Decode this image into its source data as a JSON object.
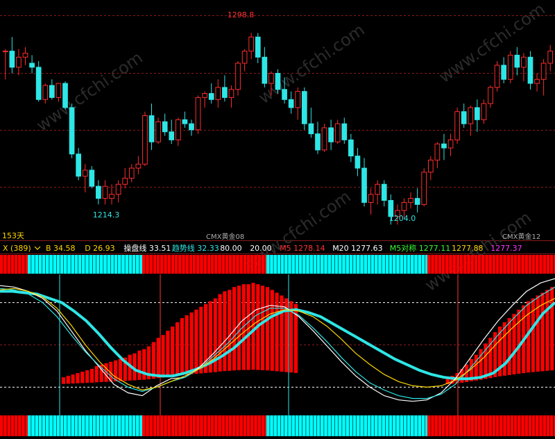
{
  "colors": {
    "up": "#ff2d2d",
    "down": "#2ee6e6",
    "white": "#ffffff",
    "grid_red": "#8b1a1a",
    "bar_red": "#ff0000",
    "bar_cyan": "#00ffff",
    "label_yellow": "#ffd700",
    "watermark": "#2b2b2b"
  },
  "main_panel": {
    "high_label": "1298.8",
    "low_label_left": "1214.3",
    "low_label_right": "1204.0",
    "period_label": "153天",
    "contract_label_mid": "CMX黄金08",
    "contract_label_right": "CMX黄金12",
    "watermark": "www.cfchi.com"
  },
  "indicator_header": {
    "dropdown_label": "X (389)",
    "items": [
      {
        "label": "B",
        "value": "34.58",
        "color": "#ffd700"
      },
      {
        "label": "D",
        "value": "26.93",
        "color": "#ffd700"
      },
      {
        "label": "操盘线",
        "value": "33.51",
        "color": "#ffffff"
      },
      {
        "label": "趋势线",
        "value": "32.33",
        "color": "#2ee6e6"
      },
      {
        "label": "",
        "value": "80.00",
        "color": "#ffffff"
      },
      {
        "label": "",
        "value": "20.00",
        "color": "#ffffff"
      },
      {
        "label": "M5",
        "value": "1278.14",
        "color": "#ff3333"
      },
      {
        "label": "M20",
        "value": "1277.63",
        "color": "#ffffff"
      },
      {
        "label": "M5对称",
        "value": "1277.11",
        "color": "#33ff33"
      },
      {
        "label": "",
        "value": "1277.88",
        "color": "#ffd700"
      },
      {
        "label": "",
        "value": "1277.37",
        "color": "#ff33ff"
      }
    ]
  },
  "chart_data": [
    {
      "type": "candlestick",
      "title": "",
      "ylim": [
        1200,
        1305
      ],
      "annotations": [
        {
          "text": "1298.8",
          "kind": "high"
        },
        {
          "text": "1214.3",
          "kind": "low"
        },
        {
          "text": "1204.0",
          "kind": "low"
        }
      ],
      "candles": [
        [
          1290,
          1291,
          1276,
          1290
        ],
        [
          1290,
          1297,
          1279,
          1282
        ],
        [
          1282,
          1291,
          1278,
          1287
        ],
        [
          1287,
          1292,
          1283,
          1289
        ],
        [
          1284,
          1288,
          1279,
          1282
        ],
        [
          1282,
          1285,
          1265,
          1266
        ],
        [
          1266,
          1274,
          1264,
          1273
        ],
        [
          1273,
          1276,
          1266,
          1267
        ],
        [
          1267,
          1274,
          1265,
          1274
        ],
        [
          1274,
          1275,
          1261,
          1262
        ],
        [
          1262,
          1264,
          1237,
          1239
        ],
        [
          1239,
          1242,
          1226,
          1228
        ],
        [
          1228,
          1234,
          1220,
          1231
        ],
        [
          1231,
          1233,
          1222,
          1223
        ],
        [
          1223,
          1226,
          1214,
          1217
        ],
        [
          1217,
          1226,
          1214,
          1223
        ],
        [
          1217,
          1224,
          1214,
          1219
        ],
        [
          1219,
          1226,
          1215,
          1224
        ],
        [
          1224,
          1232,
          1222,
          1227
        ],
        [
          1227,
          1234,
          1225,
          1232
        ],
        [
          1232,
          1238,
          1229,
          1234
        ],
        [
          1234,
          1260,
          1233,
          1258
        ],
        [
          1258,
          1264,
          1241,
          1245
        ],
        [
          1245,
          1257,
          1244,
          1255
        ],
        [
          1255,
          1259,
          1248,
          1250
        ],
        [
          1250,
          1256,
          1244,
          1246
        ],
        [
          1246,
          1257,
          1243,
          1256
        ],
        [
          1256,
          1260,
          1252,
          1254
        ],
        [
          1254,
          1256,
          1248,
          1251
        ],
        [
          1251,
          1268,
          1249,
          1267
        ],
        [
          1267,
          1270,
          1262,
          1269
        ],
        [
          1269,
          1274,
          1264,
          1266
        ],
        [
          1266,
          1276,
          1262,
          1272
        ],
        [
          1272,
          1278,
          1265,
          1267
        ],
        [
          1267,
          1273,
          1262,
          1271
        ],
        [
          1271,
          1285,
          1268,
          1284
        ],
        [
          1284,
          1291,
          1280,
          1290
        ],
        [
          1290,
          1299,
          1286,
          1297
        ],
        [
          1297,
          1299,
          1284,
          1287
        ],
        [
          1287,
          1292,
          1272,
          1274
        ],
        [
          1274,
          1280,
          1268,
          1279
        ],
        [
          1279,
          1281,
          1269,
          1271
        ],
        [
          1271,
          1277,
          1264,
          1266
        ],
        [
          1266,
          1270,
          1259,
          1262
        ],
        [
          1262,
          1272,
          1256,
          1270
        ],
        [
          1270,
          1272,
          1251,
          1254
        ],
        [
          1254,
          1262,
          1247,
          1249
        ],
        [
          1249,
          1255,
          1239,
          1241
        ],
        [
          1241,
          1254,
          1240,
          1252
        ],
        [
          1252,
          1256,
          1241,
          1245
        ],
        [
          1245,
          1256,
          1244,
          1254
        ],
        [
          1254,
          1257,
          1244,
          1246
        ],
        [
          1246,
          1249,
          1235,
          1238
        ],
        [
          1238,
          1242,
          1228,
          1232
        ],
        [
          1232,
          1237,
          1213,
          1215
        ],
        [
          1215,
          1222,
          1209,
          1219
        ],
        [
          1219,
          1226,
          1214,
          1224
        ],
        [
          1224,
          1226,
          1213,
          1216
        ],
        [
          1216,
          1219,
          1204,
          1208
        ],
        [
          1208,
          1214,
          1204,
          1211
        ],
        [
          1211,
          1217,
          1207,
          1215
        ],
        [
          1215,
          1220,
          1212,
          1217
        ],
        [
          1217,
          1222,
          1210,
          1214
        ],
        [
          1214,
          1232,
          1213,
          1230
        ],
        [
          1230,
          1238,
          1226,
          1236
        ],
        [
          1236,
          1245,
          1232,
          1244
        ],
        [
          1244,
          1249,
          1236,
          1242
        ],
        [
          1242,
          1249,
          1238,
          1246
        ],
        [
          1246,
          1262,
          1244,
          1260
        ],
        [
          1260,
          1264,
          1252,
          1254
        ],
        [
          1254,
          1263,
          1248,
          1262
        ],
        [
          1262,
          1266,
          1250,
          1256
        ],
        [
          1256,
          1266,
          1254,
          1264
        ],
        [
          1264,
          1273,
          1262,
          1272
        ],
        [
          1272,
          1285,
          1270,
          1283
        ],
        [
          1283,
          1287,
          1274,
          1276
        ],
        [
          1276,
          1290,
          1274,
          1288
        ],
        [
          1288,
          1292,
          1278,
          1282
        ],
        [
          1282,
          1289,
          1275,
          1287
        ],
        [
          1287,
          1290,
          1271,
          1274
        ],
        [
          1274,
          1279,
          1270,
          1276
        ],
        [
          1276,
          1286,
          1268,
          1284
        ],
        [
          1284,
          1293,
          1280,
          1290
        ]
      ]
    },
    {
      "type": "line",
      "title": "",
      "ylim": [
        0,
        100
      ],
      "reference_lines": [
        80,
        20
      ],
      "series": [
        {
          "name": "趋势线",
          "color": "#2ee6e6",
          "values": [
            88,
            88,
            87,
            86,
            83,
            80,
            74,
            67,
            58,
            48,
            39,
            32,
            29,
            28,
            28,
            30,
            33,
            37,
            42,
            48,
            56,
            64,
            70,
            74,
            75,
            73,
            70,
            65,
            60,
            55,
            50,
            45,
            40,
            36,
            32,
            29,
            27,
            26,
            26,
            27,
            30,
            37,
            48,
            60,
            72,
            80
          ]
        },
        {
          "name": "",
          "color": "#ffffff",
          "values": [
            92,
            91,
            88,
            83,
            74,
            60,
            46,
            34,
            22,
            16,
            14,
            21,
            26,
            27,
            34,
            44,
            55,
            67,
            75,
            78,
            77,
            70,
            60,
            49,
            38,
            28,
            20,
            14,
            11,
            10,
            11,
            16,
            26,
            40,
            54,
            67,
            78,
            88,
            94,
            97
          ]
        },
        {
          "name": "",
          "color": "#2ee6e6",
          "values": [
            90,
            89,
            86,
            80,
            70,
            57,
            45,
            35,
            26,
            20,
            17,
            20,
            24,
            27,
            33,
            42,
            51,
            62,
            71,
            76,
            76,
            71,
            62,
            52,
            41,
            31,
            23,
            18,
            14,
            12,
            12,
            15,
            22,
            33,
            45,
            57,
            68,
            78,
            85,
            91
          ]
        },
        {
          "name": "B",
          "color": "#ffd700",
          "values": [
            89,
            90,
            88,
            84,
            76,
            64,
            50,
            38,
            28,
            22,
            18,
            20,
            24,
            28,
            33,
            40,
            49,
            58,
            66,
            72,
            75,
            74,
            70,
            63,
            54,
            44,
            36,
            29,
            24,
            21,
            20,
            21,
            25,
            32,
            41,
            52,
            62,
            71,
            78,
            83
          ]
        }
      ],
      "histogram": [
        null,
        null,
        null,
        null,
        null,
        null,
        null,
        null,
        null,
        null,
        null,
        null,
        null,
        2,
        3,
        4,
        5,
        6,
        7,
        8,
        10,
        11,
        12,
        13,
        14,
        15,
        16,
        18,
        19,
        21,
        22,
        24,
        27,
        30,
        32,
        35,
        38,
        41,
        44,
        46,
        48,
        50,
        52,
        54,
        56,
        58,
        61,
        63,
        64,
        66,
        67,
        68,
        68,
        69,
        68,
        67,
        66,
        64,
        62,
        60,
        58,
        56,
        54,
        null,
        null,
        null,
        null,
        null,
        null,
        null,
        null,
        null,
        null,
        null,
        null,
        null,
        null,
        null,
        null,
        null,
        null,
        null,
        null,
        null,
        null,
        null,
        null,
        null,
        null,
        null,
        null,
        null,
        null,
        null,
        1,
        3,
        5,
        8,
        11,
        15,
        18,
        22,
        26,
        30,
        34,
        38,
        41,
        44,
        47,
        50,
        53,
        56,
        58,
        60,
        62,
        64,
        66
      ]
    }
  ]
}
